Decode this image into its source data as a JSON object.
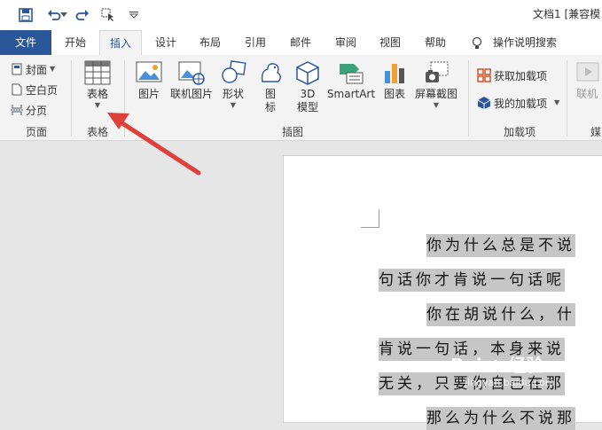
{
  "title_bar": {
    "doc_title": "文档1 [兼容模"
  },
  "tabs": [
    "文件",
    "开始",
    "插入",
    "设计",
    "布局",
    "引用",
    "邮件",
    "审阅",
    "视图",
    "帮助"
  ],
  "tell_me": "操作说明搜索",
  "ribbon": {
    "pages_group": {
      "label": "页面",
      "cover": "封面",
      "blank": "空白页",
      "break": "分页"
    },
    "tables_group": {
      "label": "表格",
      "table": "表格"
    },
    "illustrations_group": {
      "label": "插图",
      "picture": "图片",
      "online_picture": "联机图片",
      "shapes": "形状",
      "icons_a": "图",
      "icons_b": "标",
      "model_a": "3D",
      "model_b": "模型",
      "smartart": "SmartArt",
      "chart": "图表",
      "screenshot": "屏幕截图"
    },
    "addins_group": {
      "label": "加载项",
      "get": "获取加载项",
      "mine": "我的加载项"
    },
    "media_group": {
      "label": "媒",
      "online_video": "联机"
    }
  },
  "document": {
    "lines": [
      "你为什么总是不说",
      "句话你才肯说一句话呢",
      "你在胡说什么，什",
      "肯说一句话，本身来说",
      "无关，只要你自己在那",
      "那么为什么不说那"
    ]
  },
  "watermark": {
    "brand": "Bai",
    "brand2": "经验",
    "url": "jingyan.baidu.com"
  },
  "colors": {
    "accent": "#2b579a",
    "arrow": "#e0403c",
    "selection": "#c6c6c6"
  }
}
